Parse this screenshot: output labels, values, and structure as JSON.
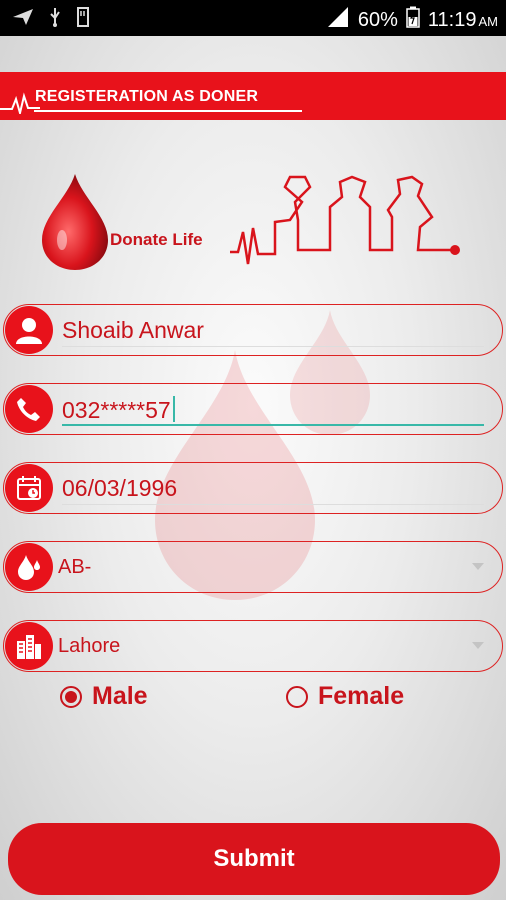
{
  "status_bar": {
    "battery_percent": "60%",
    "time": "11:19",
    "ampm": "AM",
    "icons": [
      "send-icon",
      "usb-icon",
      "sd-card-icon",
      "signal-icon",
      "battery-icon"
    ]
  },
  "header": {
    "title": "REGISTERATION AS DONER"
  },
  "logo": {
    "text": "Donate Life"
  },
  "form": {
    "name": {
      "value": "Shoaib Anwar",
      "icon": "person-icon"
    },
    "phone": {
      "value": "032*****57",
      "icon": "phone-icon"
    },
    "dob": {
      "value": "06/03/1996",
      "icon": "calendar-icon"
    },
    "blood_group": {
      "value": "AB-",
      "icon": "blood-drop-icon"
    },
    "city": {
      "value": "Lahore",
      "icon": "city-icon"
    },
    "gender": {
      "male_label": "Male",
      "female_label": "Female",
      "selected": "Male"
    }
  },
  "submit_label": "Submit",
  "colors": {
    "primary": "#e8121b",
    "accent_line": "#38b8a8"
  }
}
